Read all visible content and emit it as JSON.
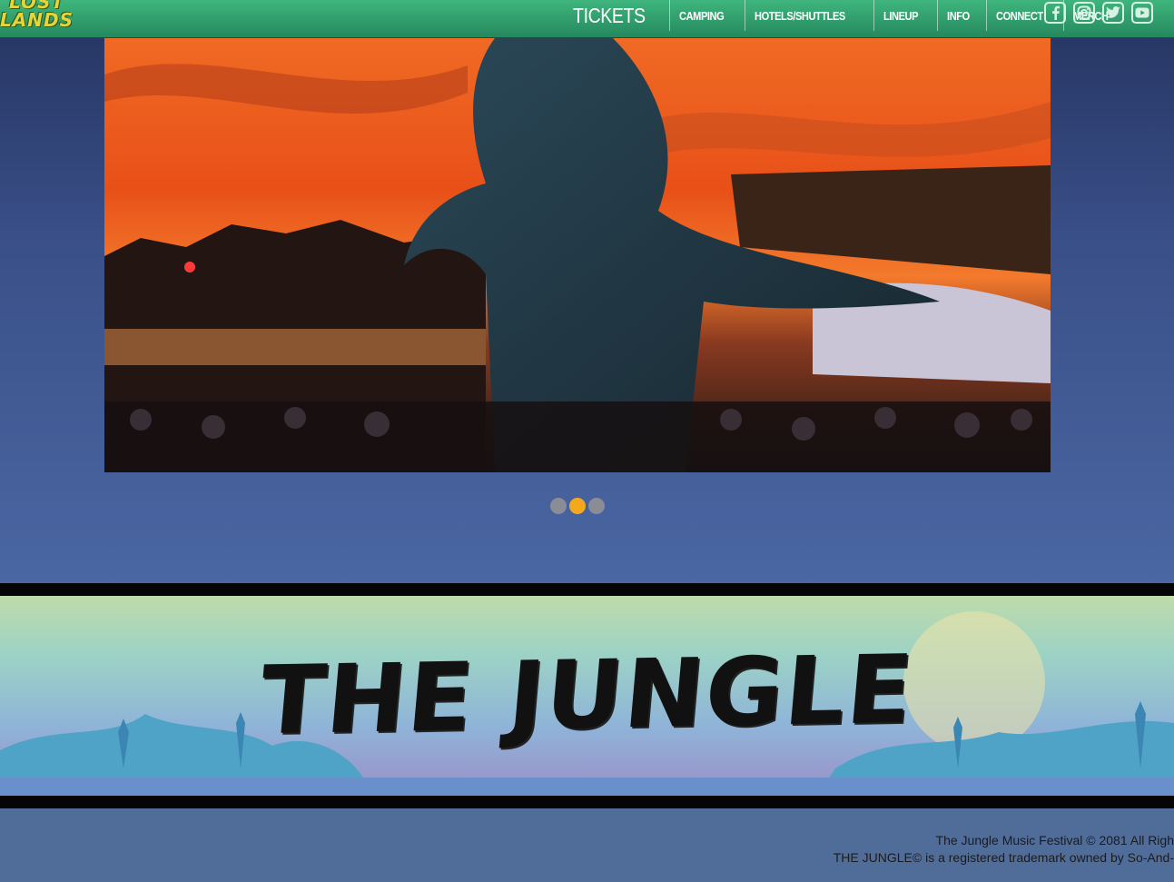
{
  "logo": {
    "line1": "LOST",
    "line2": "LANDS"
  },
  "nav": {
    "items": [
      "TICKETS",
      "CAMPING",
      "HOTELS/SHUTTLES",
      "LINEUP",
      "INFO",
      "CONNECT",
      "MERCH"
    ]
  },
  "socials": [
    "facebook-icon",
    "instagram-icon",
    "twitter-icon",
    "youtube-icon"
  ],
  "colors": {
    "nav_green": "#2ea06c",
    "accent_orange": "#f4a81b",
    "background_blue": "#4a67a3"
  },
  "carousel": {
    "slide_count": 3,
    "active_index": 1
  },
  "banner": {
    "title": "THE JUNGLE"
  },
  "footer": {
    "line1": "The Jungle Music Festival © 2081 All Righ",
    "line2": "THE JUNGLE© is a registered trademark owned by So-And-"
  }
}
